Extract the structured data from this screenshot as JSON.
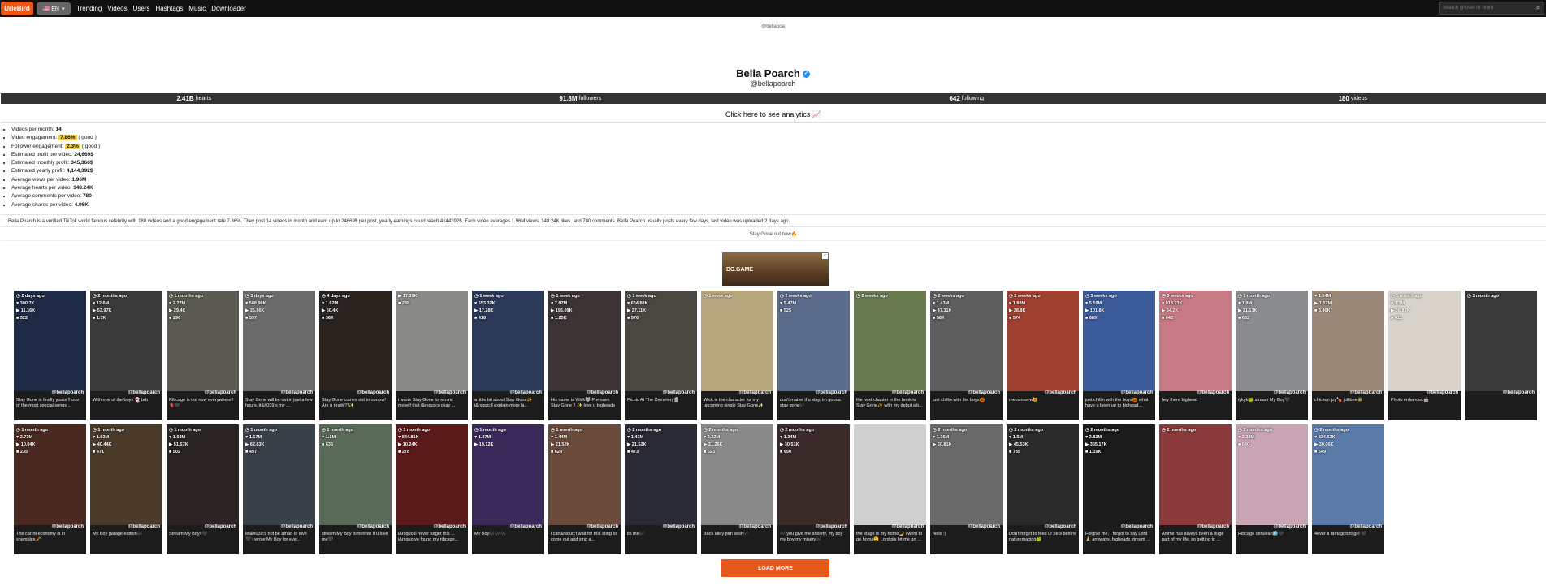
{
  "nav": {
    "logo": "UrleBird",
    "lang": "🇺🇸 EN",
    "links": [
      "Trending",
      "Videos",
      "Users",
      "Hashtags",
      "Music",
      "Downloader"
    ],
    "search_placeholder": "Search @User or Word"
  },
  "profile": {
    "avatar_text": "@bellapoa",
    "name": "Bella Poarch",
    "handle": "@bellapoarch",
    "stats": [
      {
        "value": "2.41B",
        "label": "hearts"
      },
      {
        "value": "91.8M",
        "label": "followers"
      },
      {
        "value": "642",
        "label": "following"
      },
      {
        "value": "180",
        "label": "videos"
      }
    ],
    "analytics_link": "Click here to see analytics 📈"
  },
  "metrics": [
    {
      "label": "Videos per month:",
      "value": "14",
      "note": ""
    },
    {
      "label": "Video engagement:",
      "value": "7.86%",
      "note": "( good )",
      "highlight": true
    },
    {
      "label": "Follower engagement:",
      "value": "2.3%",
      "note": "( good )",
      "highlight": true
    },
    {
      "label": "Estimated profit per video:",
      "value": "24,669$",
      "note": ""
    },
    {
      "label": "Estimated monthly profit:",
      "value": "345,366$",
      "note": ""
    },
    {
      "label": "Estimated yearly profit:",
      "value": "4,144,392$",
      "note": ""
    },
    {
      "label": "Average views per video:",
      "value": "1.96M",
      "note": ""
    },
    {
      "label": "Average hearts per video:",
      "value": "148.24K",
      "note": ""
    },
    {
      "label": "Average comments per video:",
      "value": "780",
      "note": ""
    },
    {
      "label": "Average shares per video:",
      "value": "4.96K",
      "note": ""
    }
  ],
  "bio": "Bella Poarch is a verified TikTok world famous celebrity with 180 videos and a good engagement rate 7.86%. They post 14 videos in month and earn up to 24669$ per post, yearly earnings could reach 4144392$. Each video averages 1.96M views, 148.24K likes, and 780 comments. Bella Poarch usually posts every few days, last video was uploaded 2 days ago.",
  "stay_text": "Stay Gone out now🔥",
  "ad": {
    "label": "BC.GAME",
    "close": "x"
  },
  "videos": [
    {
      "age": "2 days ago",
      "likes": "300.7K",
      "views": "11.16K",
      "comments": "322",
      "user": "@bellapoarch",
      "caption": "Stay Gone is finally yours !! one of the most special songs ...",
      "color": "#1e2a44"
    },
    {
      "age": "2 months ago",
      "likes": "12.6M",
      "views": "53.97K",
      "comments": "1.7K",
      "user": "@bellapoarch",
      "caption": "With one of the boys 👻 brb",
      "color": "#3a3a3a"
    },
    {
      "age": "1 months ago",
      "likes": "2.77M",
      "views": "29.4K",
      "comments": "296",
      "user": "@bellapoarch",
      "caption": "Ribcage is out now everywhere!! 🫀🖤",
      "color": "#5a5a52"
    },
    {
      "age": "3 days ago",
      "likes": "588.98K",
      "views": "35.86K",
      "comments": "537",
      "user": "@bellapoarch",
      "caption": "Stay Gone will be out in just a few hours. it&#039;s my ...",
      "color": "#6b6b6b"
    },
    {
      "age": "4 days ago",
      "likes": "1.62M",
      "views": "50.4K",
      "comments": "364",
      "user": "@bellapoarch",
      "caption": "Stay Gone comes out tomorrow! Are u ready?!✨",
      "color": "#2a2420"
    },
    {
      "age": "",
      "likes": "",
      "views": "17.35K",
      "comments": "238",
      "user": "@bellapoarch",
      "caption": "i wrote Stay Gone to remind myself that i&rsquo;s okay ...",
      "color": "#8a8a86"
    },
    {
      "age": "1 week ago",
      "likes": "653.32K",
      "views": "17.28K",
      "comments": "418",
      "user": "@bellapoarch",
      "caption": "a little bit about Stay Gone✨ i&rsquo;ll explain more la...",
      "color": "#2c3a5a"
    },
    {
      "age": "1 week ago",
      "likes": "7.87M",
      "views": "196.09K",
      "comments": "1.25K",
      "user": "@bellapoarch",
      "caption": "His name is Wick🐺 Pre-save Stay Gone !! ✨ love u bigheads",
      "color": "#3c3434"
    },
    {
      "age": "1 week ago",
      "likes": "654.88K",
      "views": "27.11K",
      "comments": "576",
      "user": "@bellapoarch",
      "caption": "Picnic At The Cemetery🪦",
      "color": "#4a4640"
    },
    {
      "age": "1 week ago",
      "likes": "",
      "views": "",
      "comments": "",
      "user": "@bellapoarch",
      "caption": "Wick is the character for my upcoming single Stay Gone✨",
      "color": "#b8a67e"
    },
    {
      "age": "2 weeks ago",
      "likes": "5.47M",
      "views": "",
      "comments": "525",
      "user": "@bellapoarch",
      "caption": "don't matter if u stay, im gonna stay gone🎶",
      "color": "#5a6a8a"
    },
    {
      "age": "2 weeks ago",
      "likes": "",
      "views": "",
      "comments": "",
      "user": "@bellapoarch",
      "caption": "the next chapter in the book is Stay Gone✨ with my debut alb...",
      "color": "#6a7a50"
    },
    {
      "age": "2 weeks ago",
      "likes": "1.43M",
      "views": "47.31K",
      "comments": "584",
      "user": "@bellapoarch",
      "caption": "just chillin with the boys🎃",
      "color": "#5e5e5e"
    },
    {
      "age": "2 weeks ago",
      "likes": "1.88M",
      "views": "38.8K",
      "comments": "574",
      "user": "@bellapoarch",
      "caption": "meowmeow🐱",
      "color": "#a04030"
    },
    {
      "age": "3 weeks ago",
      "likes": "5.59M",
      "views": "101.8K",
      "comments": "689",
      "user": "@bellapoarch",
      "caption": "just chillin with the boys🎃 what have u been up to bighead...",
      "color": "#3a5a9a"
    },
    {
      "age": "3 weeks ago",
      "likes": "918.23K",
      "views": "34.2K",
      "comments": "642",
      "user": "@bellapoarch",
      "caption": "hey there bighead",
      "color": "#c87a84"
    },
    {
      "age": "1 month ago",
      "likes": "1.8M",
      "views": "31.13K",
      "comments": "632",
      "user": "@bellapoarch",
      "caption": "iykyk🐸 stream My Boy🖤",
      "color": "#8a8c90"
    },
    {
      "age": "",
      "likes": "1.04M",
      "views": "1.52M",
      "comments": "3.46K",
      "user": "@bellapoarch",
      "caption": "chicken joy🍗 jollibee🐝",
      "color": "#9a8878"
    },
    {
      "age": "1 month ago",
      "likes": "1.3M",
      "views": "36.83K",
      "comments": "411",
      "user": "@bellapoarch",
      "caption": "Photo enhanced🤖",
      "color": "#d8d4cc"
    },
    {
      "age": "1 month ago",
      "likes": "",
      "views": "",
      "comments": "",
      "user": "@bellapoarch",
      "caption": "",
      "color": "#3a3a3a"
    },
    {
      "age": "1 month ago",
      "likes": "2.73M",
      "views": "10.04K",
      "comments": "235",
      "user": "@bellapoarch",
      "caption": "The carrot economy is in shambles🥕",
      "color": "#4a2a20"
    },
    {
      "age": "1 month ago",
      "likes": "1.63M",
      "views": "40.44K",
      "comments": "471",
      "user": "@bellapoarch",
      "caption": "My Boy garage edition🎶",
      "color": "#4a3a2a"
    },
    {
      "age": "1 month ago",
      "likes": "1.68M",
      "views": "51.57K",
      "comments": "502",
      "user": "@bellapoarch",
      "caption": "Stream My Boy!!🖤",
      "color": "#2a2422"
    },
    {
      "age": "1 month ago",
      "likes": "1.17M",
      "views": "62.83K",
      "comments": "497",
      "user": "@bellapoarch",
      "caption": "let&#039;s not be afraid of love 🖤 i wrote My Boy for eve...",
      "color": "#3a4048"
    },
    {
      "age": "1 month ago",
      "likes": "1.1M",
      "views": "",
      "comments": "635",
      "user": "@bellapoarch",
      "caption": "stream My Boy tomorrow if u love me🖤",
      "color": "#5a6a58"
    },
    {
      "age": "1 month ago",
      "likes": "844.81K",
      "views": "10.24K",
      "comments": "278",
      "user": "@bellapoarch",
      "caption": "i&rsquo;ll never forget this ... i&rsquo;ve found my ribcage...",
      "color": "#5a1a1a"
    },
    {
      "age": "1 month ago",
      "likes": "1.37M",
      "views": "19.12K",
      "comments": "",
      "user": "@bellapoarch",
      "caption": "My Boy🎶🎶🎶",
      "color": "#3a2a5a"
    },
    {
      "age": "1 month ago",
      "likes": "1.44M",
      "views": "21.52K",
      "comments": "624",
      "user": "@bellapoarch",
      "caption": "i can&rsquo;t wait for this song to come out and sing a...",
      "color": "#6a4a3a"
    },
    {
      "age": "2 months ago",
      "likes": "1.41M",
      "views": "21.52K",
      "comments": "473",
      "user": "@bellapoarch",
      "caption": "its me🎶",
      "color": "#2a2a34"
    },
    {
      "age": "2 months ago",
      "likes": "2.22M",
      "views": "31.26K",
      "comments": "623",
      "user": "@bellapoarch",
      "caption": "Back alley pen sesh🎶",
      "color": "#8a8a8a"
    },
    {
      "age": "2 months ago",
      "likes": "1.34M",
      "views": "30.51K",
      "comments": "650",
      "user": "@bellapoarch",
      "caption": "🎶 you give me anxiety, my boy my boy my misery🎶",
      "color": "#3a2a2a"
    },
    {
      "age": "",
      "likes": "",
      "views": "",
      "comments": "",
      "user": "@bellapoarch",
      "caption": "the stage is my home🌙 i went to go home😩 Lord pls let me go ...",
      "color": "#cfcfcf"
    },
    {
      "age": "2 months ago",
      "likes": "1.36M",
      "views": "60.81K",
      "comments": "",
      "user": "@bellapoarch",
      "caption": "hello :)",
      "color": "#6a6a6a"
    },
    {
      "age": "2 months ago",
      "likes": "1.5M",
      "views": "45.53K",
      "comments": "785",
      "user": "@bellapoarch",
      "caption": "Don't forget to feed ur pets before naturemaxing🐸",
      "color": "#2a2a2a"
    },
    {
      "age": "2 months ago",
      "likes": "3.82M",
      "views": "355.17K",
      "comments": "1.19K",
      "user": "@bellapoarch",
      "caption": "Forgive me, I forgot to say Lord🙏 anyways, bigheads stream ...",
      "color": "#1a1a1a"
    },
    {
      "age": "2 months ago",
      "likes": "",
      "views": "",
      "comments": "",
      "user": "@bellapoarch",
      "caption": "Anime has always been a huge part of my life, so getting to ...",
      "color": "#8a3a3a"
    },
    {
      "age": "2 months ago",
      "likes": "2.38M",
      "views": "",
      "comments": "640",
      "user": "@bellapoarch",
      "caption": "Ribcage cerulean🧊🖤",
      "color": "#c8a4b4"
    },
    {
      "age": "2 months ago",
      "likes": "834.62K",
      "views": "30.06K",
      "comments": "549",
      "user": "@bellapoarch",
      "caption": "4ever a tamagotchi girl 🖤",
      "color": "#5a7aa8"
    }
  ],
  "load_more": "LOAD MORE"
}
